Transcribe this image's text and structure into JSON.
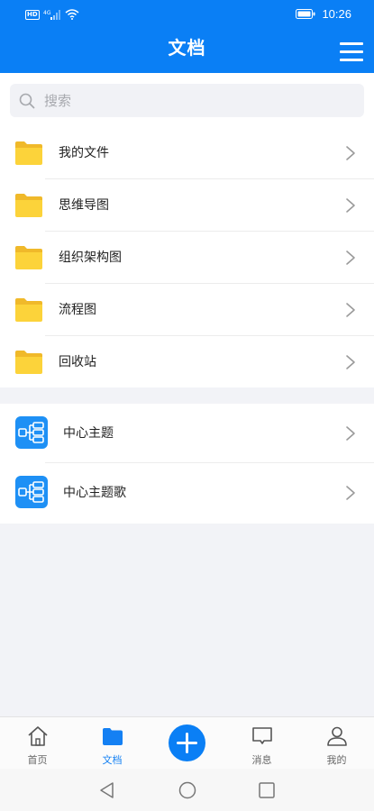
{
  "status_bar": {
    "network_badge": "HD",
    "signal_label": "4G",
    "time": "10:26"
  },
  "header": {
    "title": "文档",
    "menu_icon": "hamburger-menu-icon"
  },
  "search": {
    "placeholder": "搜索",
    "value": ""
  },
  "folders": [
    {
      "label": "我的文件",
      "icon": "folder-icon"
    },
    {
      "label": "思维导图",
      "icon": "folder-icon"
    },
    {
      "label": "组织架构图",
      "icon": "folder-icon"
    },
    {
      "label": "流程图",
      "icon": "folder-icon"
    },
    {
      "label": "回收站",
      "icon": "folder-icon"
    }
  ],
  "files": [
    {
      "label": "中心主题",
      "icon": "mindmap-icon"
    },
    {
      "label": "中心主题歌",
      "icon": "mindmap-icon"
    }
  ],
  "tabbar": {
    "tabs": [
      {
        "label": "首页",
        "icon": "home-icon"
      },
      {
        "label": "文档",
        "icon": "folder-icon",
        "active": true
      },
      {
        "label": "",
        "icon": "plus-icon"
      },
      {
        "label": "消息",
        "icon": "message-icon"
      },
      {
        "label": "我的",
        "icon": "user-icon"
      }
    ]
  },
  "colors": {
    "brand_blue": "#0a7ff5",
    "folder_yellow": "#fcd33a",
    "active_tab": "#1480f3"
  }
}
